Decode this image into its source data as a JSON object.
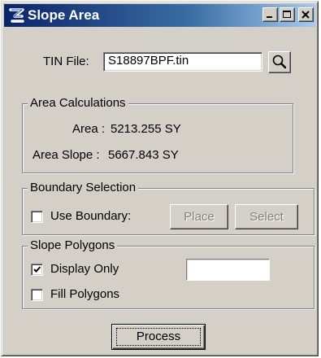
{
  "window": {
    "title": "Slope Area"
  },
  "tin": {
    "label": "TIN File:",
    "value": "S18897BPF.tin"
  },
  "area_calculations": {
    "title": "Area Calculations",
    "area_label": "Area :",
    "area_value": "5213.255 SY",
    "slope_label": "Area Slope :",
    "slope_value": "5667.843 SY"
  },
  "boundary_selection": {
    "title": "Boundary Selection",
    "use_boundary_label": "Use Boundary:",
    "use_boundary_checked": false,
    "place_label": "Place",
    "select_label": "Select"
  },
  "slope_polygons": {
    "title": "Slope Polygons",
    "display_only_label": "Display Only",
    "display_only_checked": true,
    "fill_polygons_label": "Fill Polygons",
    "fill_polygons_checked": false
  },
  "process_label": "Process",
  "icons": {
    "app": "app-logo-icon",
    "search": "magnifier-icon",
    "minimize": "minimize-icon",
    "maximize": "maximize-icon",
    "close": "close-icon"
  },
  "colors": {
    "titlebar_start": "#0a246a",
    "titlebar_end": "#a6caf0",
    "face": "#d4d0c8",
    "disabled_text": "#808080"
  }
}
